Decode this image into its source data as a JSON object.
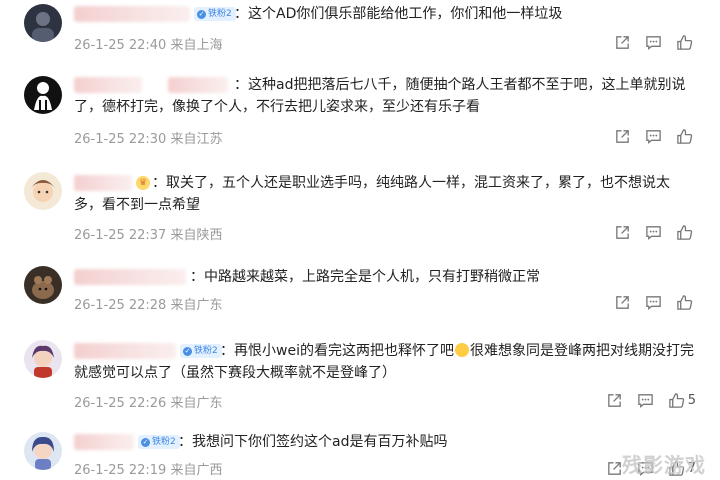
{
  "comments": [
    {
      "text": "：这个AD你们俱乐部能给他工作，你们和他一样垃圾",
      "time": "26-1-25 22:40",
      "location": "来自上海",
      "badge": "铁粉2",
      "likes": ""
    },
    {
      "text": "：这种ad把把落后七八千，随便抽个路人王者都不至于吧，这上单就别说了，德杯打完，像换了个人，不行去把儿姿求来，至少还有乐子看",
      "time": "26-1-25 22:30",
      "location": "来自江苏",
      "badge": "",
      "likes": ""
    },
    {
      "text": "：取关了，五个人还是职业选手吗，纯纯路人一样，混工资来了，累了，也不想说太多，看不到一点希望",
      "time": "26-1-25 22:37",
      "location": "来自陕西",
      "badge": "",
      "likes": ""
    },
    {
      "text": "：中路越来越菜，上路完全是个人机，只有打野稍微正常",
      "time": "26-1-25 22:28",
      "location": "来自广东",
      "badge": "",
      "likes": ""
    },
    {
      "text_a": "：再恨小wei的看完这两把也释怀了吧",
      "text_b": "很难想象同是登峰两把对线期没打完就感觉可以点了（虽然下赛段大概率就不是登峰了）",
      "time": "26-1-25 22:26",
      "location": "来自广东",
      "badge": "铁粉2",
      "likes": "5"
    },
    {
      "text": "：我想问下你们签约这个ad是有百万补贴吗",
      "time": "26-1-25 22:19",
      "location": "来自广西",
      "badge": "铁粉2",
      "likes": "7"
    }
  ],
  "icons": {
    "share": "share-icon",
    "comment": "comment-icon",
    "like": "thumbs-up-icon"
  },
  "watermark": "残影游戏",
  "colors": {
    "meta_text": "#9a9a9a",
    "badge_bg": "#e3f0ff",
    "badge_fg": "#3d86e6"
  }
}
